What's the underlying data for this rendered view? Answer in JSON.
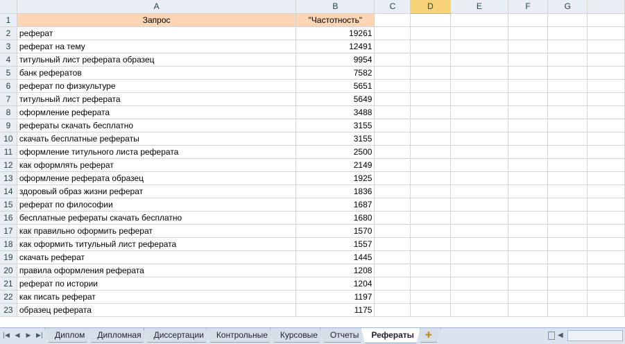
{
  "columns": [
    "A",
    "B",
    "C",
    "D",
    "E",
    "F",
    "G"
  ],
  "active_column": "D",
  "header_row": {
    "row": "1",
    "a": "Запрос",
    "b": "\"Частотность\""
  },
  "rows": [
    {
      "n": "2",
      "q": "реферат",
      "v": "19261"
    },
    {
      "n": "3",
      "q": "реферат на тему",
      "v": "12491"
    },
    {
      "n": "4",
      "q": "титульный лист реферата образец",
      "v": "9954"
    },
    {
      "n": "5",
      "q": "банк рефератов",
      "v": "7582"
    },
    {
      "n": "6",
      "q": "реферат по физкультуре",
      "v": "5651"
    },
    {
      "n": "7",
      "q": "титульный лист реферата",
      "v": "5649"
    },
    {
      "n": "8",
      "q": "оформление реферата",
      "v": "3488"
    },
    {
      "n": "9",
      "q": "рефераты скачать бесплатно",
      "v": "3155"
    },
    {
      "n": "10",
      "q": "скачать бесплатные рефераты",
      "v": "3155"
    },
    {
      "n": "11",
      "q": "оформление титульного листа реферата",
      "v": "2500"
    },
    {
      "n": "12",
      "q": "как оформлять реферат",
      "v": "2149"
    },
    {
      "n": "13",
      "q": "оформление реферата образец",
      "v": "1925"
    },
    {
      "n": "14",
      "q": "здоровый образ жизни реферат",
      "v": "1836"
    },
    {
      "n": "15",
      "q": "реферат по философии",
      "v": "1687"
    },
    {
      "n": "16",
      "q": "бесплатные рефераты скачать бесплатно",
      "v": "1680"
    },
    {
      "n": "17",
      "q": "как правильно оформить реферат",
      "v": "1570"
    },
    {
      "n": "18",
      "q": "как оформить титульный лист реферата",
      "v": "1557"
    },
    {
      "n": "19",
      "q": "скачать реферат",
      "v": "1445"
    },
    {
      "n": "20",
      "q": "правила оформления реферата",
      "v": "1208"
    },
    {
      "n": "21",
      "q": "реферат по истории",
      "v": "1204"
    },
    {
      "n": "22",
      "q": "как писать реферат",
      "v": "1197"
    },
    {
      "n": "23",
      "q": "образец реферата",
      "v": "1175"
    }
  ],
  "sheet_tabs": [
    "Диплом",
    "Дипломная",
    "Диссертации",
    "Контрольные",
    "Курсовые",
    "Отчеты",
    "Рефераты"
  ],
  "active_tab": "Рефераты",
  "nav_icons": [
    "first-sheet-icon",
    "prev-sheet-icon",
    "next-sheet-icon",
    "last-sheet-icon"
  ],
  "colors": {
    "header_fill": "#fcd5b4",
    "active_col": "#f8d37a",
    "grid_header": "#e9edf4"
  }
}
